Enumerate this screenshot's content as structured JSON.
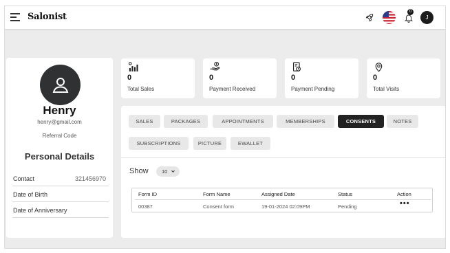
{
  "topbar": {
    "logo": "Salonist",
    "notification_count": "0",
    "user_initial": "J"
  },
  "profile": {
    "name": "Henry",
    "email": "henry@gmail.com",
    "referral_label": "Referral Code",
    "section_title": "Personal Details",
    "rows": [
      {
        "label": "Contact",
        "value": "321456970"
      },
      {
        "label": "Date of Birth",
        "value": ""
      },
      {
        "label": "Date of Anniversary",
        "value": ""
      }
    ]
  },
  "stats": [
    {
      "value": "0",
      "label": "Total Sales",
      "icon": "sales-chart-icon"
    },
    {
      "value": "0",
      "label": "Payment Received",
      "icon": "payment-hand-icon"
    },
    {
      "value": "0",
      "label": "Payment Pending",
      "icon": "pending-invoice-icon"
    },
    {
      "value": "0",
      "label": "Total Visits",
      "icon": "visit-location-icon"
    }
  ],
  "tabs": [
    {
      "label": "SALES",
      "active": false
    },
    {
      "label": "PACKAGES",
      "active": false
    },
    {
      "label": "APPOINTMENTS",
      "active": false
    },
    {
      "label": "MEMBERSHIPS",
      "active": false
    },
    {
      "label": "CONSENTS",
      "active": true
    },
    {
      "label": "NOTES",
      "active": false
    },
    {
      "label": "SUBSCRIPTIONS",
      "active": false
    },
    {
      "label": "PICTURE",
      "active": false
    },
    {
      "label": "EWALLET",
      "active": false
    }
  ],
  "show": {
    "label": "Show",
    "value": "10"
  },
  "table": {
    "columns": [
      "Form ID",
      "Form Name",
      "Assigned Date",
      "Status",
      "Action"
    ],
    "rows": [
      {
        "form_id": "00387",
        "form_name": "Consent form",
        "assigned_date": "19-01-2024 02:09PM",
        "status": "Pending",
        "action": "•••"
      }
    ]
  },
  "colors": {
    "active_tab": "#222222",
    "page_bg": "#ececec",
    "avatar_bg": "#2f3133"
  }
}
